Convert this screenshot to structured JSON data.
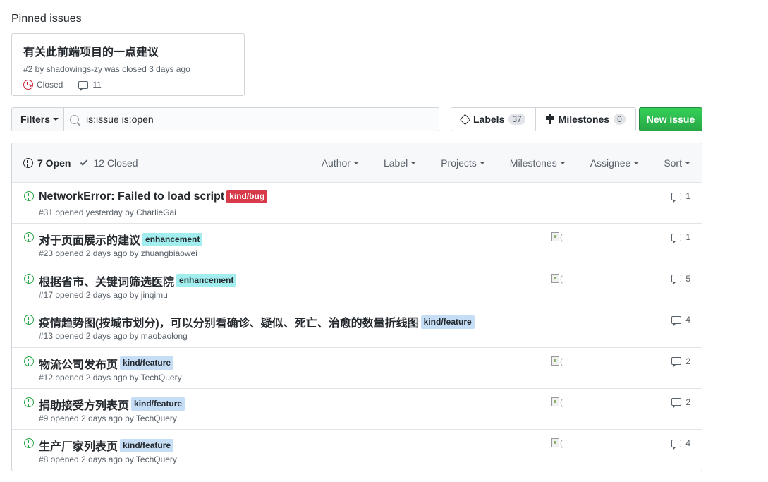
{
  "pinned": {
    "heading": "Pinned issues",
    "card": {
      "title": "有关此前端项目的一点建议",
      "meta": "#2 by shadowings-zy was closed 3 days ago",
      "state": "Closed",
      "comments": "11"
    }
  },
  "toolbar": {
    "filters_label": "Filters",
    "search_value": "is:issue is:open",
    "labels_label": "Labels",
    "labels_count": "37",
    "milestones_label": "Milestones",
    "milestones_count": "0",
    "new_issue_label": "New issue"
  },
  "list_header": {
    "open_label": "7 Open",
    "closed_label": "12 Closed",
    "filters": [
      "Author",
      "Label",
      "Projects",
      "Milestones",
      "Assignee",
      "Sort"
    ]
  },
  "colors": {
    "open_green": "#28a745",
    "bug": "#d73a4a",
    "enhancement": "#a2eeef",
    "feature": "#c5def5",
    "button_green": "#2ea44f"
  },
  "issues": [
    {
      "title": "NetworkError: Failed to load script",
      "label": "kind/bug",
      "label_type": "bug",
      "meta": "#31 opened yesterday by CharlieGai",
      "comments": "1",
      "avatar": false
    },
    {
      "title": "对于页面展示的建议",
      "label": "enhancement",
      "label_type": "enh",
      "meta": "#23 opened 2 days ago by zhuangbiaowei",
      "comments": "1",
      "avatar": true
    },
    {
      "title": "根据省市、关键词筛选医院",
      "label": "enhancement",
      "label_type": "enh",
      "meta": "#17 opened 2 days ago by jinqimu",
      "comments": "5",
      "avatar": true
    },
    {
      "title": "疫情趋势图(按城市划分)，可以分别看确诊、疑似、死亡、治愈的数量折线图",
      "label": "kind/feature",
      "label_type": "feat",
      "meta": "#13 opened 2 days ago by maobaolong",
      "comments": "4",
      "avatar": false
    },
    {
      "title": "物流公司发布页",
      "label": "kind/feature",
      "label_type": "feat",
      "meta": "#12 opened 2 days ago by TechQuery",
      "comments": "2",
      "avatar": true
    },
    {
      "title": "捐助接受方列表页",
      "label": "kind/feature",
      "label_type": "feat",
      "meta": "#9 opened 2 days ago by TechQuery",
      "comments": "2",
      "avatar": true
    },
    {
      "title": "生产厂家列表页",
      "label": "kind/feature",
      "label_type": "feat",
      "meta": "#8 opened 2 days ago by TechQuery",
      "comments": "4",
      "avatar": true
    }
  ]
}
